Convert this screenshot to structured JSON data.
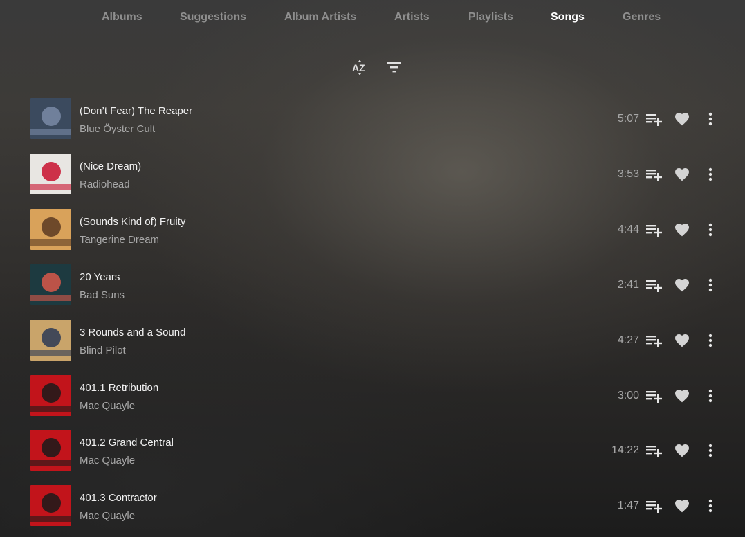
{
  "tabs": [
    {
      "label": "Albums",
      "active": false
    },
    {
      "label": "Suggestions",
      "active": false
    },
    {
      "label": "Album Artists",
      "active": false
    },
    {
      "label": "Artists",
      "active": false
    },
    {
      "label": "Playlists",
      "active": false
    },
    {
      "label": "Songs",
      "active": true
    },
    {
      "label": "Genres",
      "active": false
    }
  ],
  "toolbar": {
    "sort_icon": "sort-az-icon",
    "filter_icon": "filter-icon"
  },
  "songs": [
    {
      "title": "(Don’t Fear) The Reaper",
      "artist": "Blue Öyster Cult",
      "duration": "5:07",
      "cover_colors": [
        "#3b4a5e",
        "#7a8aa6"
      ]
    },
    {
      "title": "(Nice Dream)",
      "artist": "Radiohead",
      "duration": "3:53",
      "cover_colors": [
        "#e8e6e2",
        "#c8102e"
      ]
    },
    {
      "title": "(Sounds Kind of) Fruity",
      "artist": "Tangerine Dream",
      "duration": "4:44",
      "cover_colors": [
        "#d9a25a",
        "#5a3a22"
      ]
    },
    {
      "title": "20 Years",
      "artist": "Bad Suns",
      "duration": "2:41",
      "cover_colors": [
        "#1d3a40",
        "#d8584a"
      ]
    },
    {
      "title": "3 Rounds and a Sound",
      "artist": "Blind Pilot",
      "duration": "4:27",
      "cover_colors": [
        "#c9a46a",
        "#2b3a55"
      ]
    },
    {
      "title": "401.1 Retribution",
      "artist": "Mac Quayle",
      "duration": "3:00",
      "cover_colors": [
        "#c2141b",
        "#1a1a1a"
      ]
    },
    {
      "title": "401.2 Grand Central",
      "artist": "Mac Quayle",
      "duration": "14:22",
      "cover_colors": [
        "#c2141b",
        "#1a1a1a"
      ]
    },
    {
      "title": "401.3 Contractor",
      "artist": "Mac Quayle",
      "duration": "1:47",
      "cover_colors": [
        "#c2141b",
        "#1a1a1a"
      ]
    }
  ],
  "icons": {
    "add_to_playlist": "playlist-add-icon",
    "favorite": "heart-icon",
    "more": "more-vertical-icon"
  }
}
